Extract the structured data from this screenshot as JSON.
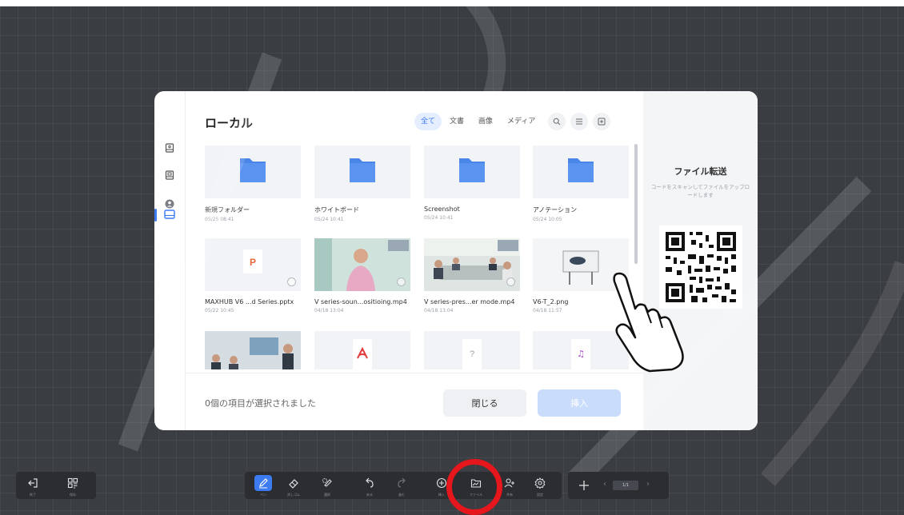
{
  "dialog": {
    "title": "ローカル",
    "filters": [
      "全て",
      "文書",
      "画像",
      "メディア"
    ],
    "active_filter": "全て",
    "items": [
      {
        "name": "新規フォルダー",
        "date": "05/25 08:41",
        "type": "folder"
      },
      {
        "name": "ホワイトボード",
        "date": "05/24 10:41",
        "type": "folder"
      },
      {
        "name": "Screenshot",
        "date": "05/24 10:41",
        "type": "folder"
      },
      {
        "name": "アノテーション",
        "date": "05/24 10:05",
        "type": "folder"
      },
      {
        "name": "MAXHUB V6 ...d Series.pptx",
        "date": "05/22 10:45",
        "type": "pptx"
      },
      {
        "name": "V series-soun...ositioing.mp4",
        "date": "04/18 13:04",
        "type": "video"
      },
      {
        "name": "V series-pres...er mode.mp4",
        "date": "04/18 13:04",
        "type": "video"
      },
      {
        "name": "V6-T_2.png",
        "date": "04/18 11:57",
        "type": "image"
      }
    ],
    "status": "0個の項目が選択されました",
    "close_label": "閉じる",
    "insert_label": "挿入"
  },
  "transfer": {
    "title": "ファイル転送",
    "description": "コードをスキャンしてファイルをアップロードします"
  },
  "toolbar": {
    "exit_label": "終了",
    "save_label": "保存",
    "pen_label": "ペン",
    "eraser_label": "消しゴム",
    "select_label": "選択",
    "undo_label": "戻る",
    "redo_label": "進む",
    "insert_label": "挿入",
    "file_label": "ファイル",
    "share_label": "共有",
    "settings_label": "設定",
    "page_indicator": "1/1"
  },
  "colors": {
    "accent": "#3c7bf0",
    "folder": "#4a86e8",
    "highlight_circle": "#e5161c",
    "background": "#3a3d42"
  }
}
